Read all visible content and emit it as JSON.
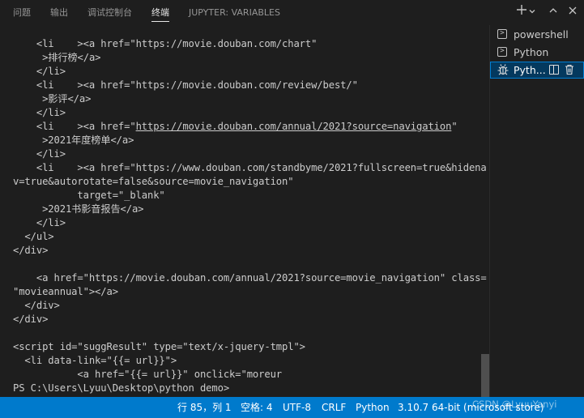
{
  "tabs": [
    {
      "label": "问题"
    },
    {
      "label": "输出"
    },
    {
      "label": "调试控制台"
    },
    {
      "label": "终端"
    },
    {
      "label": "JUPYTER: VARIABLES"
    }
  ],
  "active_tab": "终端",
  "terminal_lines": [
    "    <li    ><a href=\"https://movie.douban.com/chart\"",
    "     >排行榜</a>",
    "    </li>",
    "    <li    ><a href=\"https://movie.douban.com/review/best/\"",
    "     >影评</a>",
    "    </li>",
    "    <li    ><a href=\"",
    "     >2021年度榜单</a>",
    "    </li>",
    "    <li    ><a href=\"https://www.douban.com/standbyme/2021?fullscreen=true&hidena",
    "v=true&autorotate=false&source=movie_navigation\"",
    "           target=\"_blank\"",
    "     >2021书影音报告</a>",
    "    </li>",
    "  </ul>",
    "</div>",
    "",
    "    <a href=\"https://movie.douban.com/annual/2021?source=movie_navigation\" class=",
    "\"movieannual\"></a>",
    "  </div>",
    "</div>",
    "",
    "<script id=\"suggResult\" type=\"text/x-jquery-tmpl\">",
    "  <li data-link=\"{{= url}}\">",
    "           <a href=\"{{= url}}\" onclick=\"moreur",
    "PS C:\\Users\\Lyuu\\Desktop\\python demo>"
  ],
  "underlined_link": {
    "url": "https://movie.douban.com/annual/2021?source=navigation",
    "after": "\""
  },
  "terminals": [
    {
      "label": "powershell",
      "icon": "terminal-icon"
    },
    {
      "label": "Python",
      "icon": "terminal-icon"
    },
    {
      "label": "Pyth...",
      "icon": "debug-icon",
      "active": true
    }
  ],
  "status": {
    "position": "行 85，列 1",
    "spaces": "空格: 4",
    "encoding": "UTF-8",
    "eol": "CRLF",
    "language": "Python",
    "interpreter": "3.10.7 64-bit (microsoft store)"
  },
  "watermark": "CSDN @LyuuYanyi",
  "colors": {
    "background": "#1e1e1e",
    "statusbar": "#007acc",
    "selected_terminal": "#04395e",
    "text": "#cccccc"
  }
}
